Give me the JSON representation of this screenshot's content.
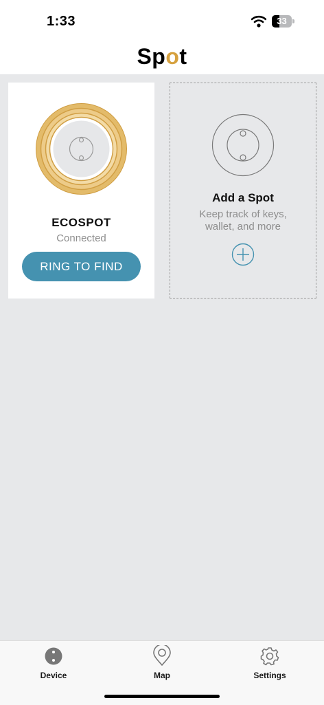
{
  "status_bar": {
    "time": "1:33",
    "battery": "33"
  },
  "header": {
    "logo_before": "Sp",
    "logo_o": "o",
    "logo_after": "t"
  },
  "device_card": {
    "name": "ECOSPOT",
    "status": "Connected",
    "button_label": "RING TO FIND"
  },
  "add_card": {
    "title": "Add a Spot",
    "subtitle": "Keep track of keys, wallet, and more"
  },
  "tabs": [
    {
      "label": "Device",
      "icon": "device-icon"
    },
    {
      "label": "Map",
      "icon": "map-pin-icon"
    },
    {
      "label": "Settings",
      "icon": "gear-icon"
    }
  ],
  "colors": {
    "accent": "#4592b0",
    "gold": "#d6a13f",
    "background": "#e7e8ea"
  }
}
